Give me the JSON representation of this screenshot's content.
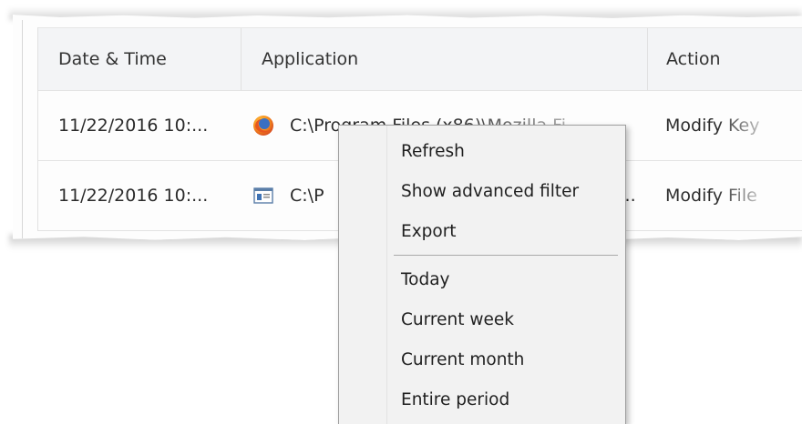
{
  "table": {
    "columns": [
      "Date & Time",
      "Application",
      "Action"
    ],
    "rows": [
      {
        "datetime": "11/22/2016 10:...",
        "application": "C:\\Program Files (x86)\\Mozilla Fi...",
        "app_icon": "firefox-icon",
        "action": "Modify Key"
      },
      {
        "datetime": "11/22/2016 10:...",
        "application": "C:\\P",
        "application_tail": "..",
        "app_icon": "window-app-icon",
        "action": "Modify File"
      }
    ]
  },
  "context_menu": {
    "items": [
      "Refresh",
      "Show advanced filter",
      "Export",
      "Today",
      "Current week",
      "Current month",
      "Entire period"
    ]
  },
  "colors": {
    "header_bg": "#f3f4f6",
    "menu_bg": "#f2f2f2",
    "grid_line": "#e3e3e3"
  }
}
